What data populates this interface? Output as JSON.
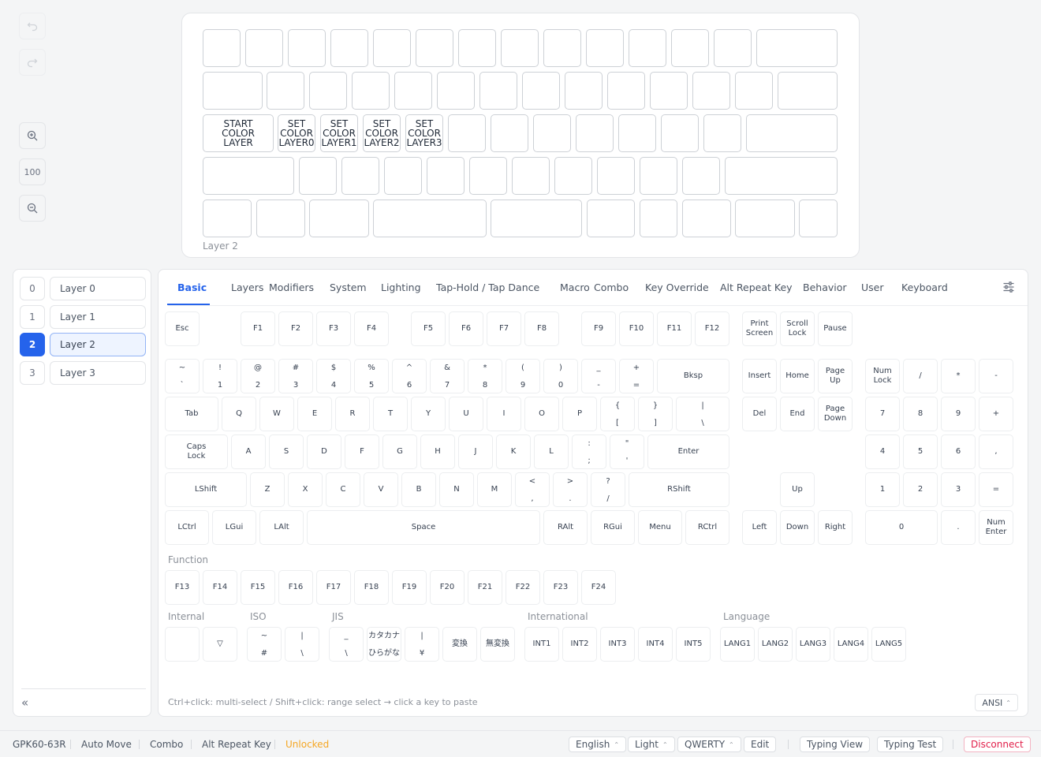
{
  "toolbar": {
    "zoom_value": "100"
  },
  "preview": {
    "layer_caption": "Layer 2",
    "special_keys": [
      "START\nCOLOR\nLAYER",
      "SET\nCOLOR\nLAYER0",
      "SET\nCOLOR\nLAYER1",
      "SET\nCOLOR\nLAYER2",
      "SET\nCOLOR\nLAYER3"
    ]
  },
  "layers": [
    {
      "num": "0",
      "name": "Layer 0"
    },
    {
      "num": "1",
      "name": "Layer 1"
    },
    {
      "num": "2",
      "name": "Layer 2"
    },
    {
      "num": "3",
      "name": "Layer 3"
    }
  ],
  "active_layer": 2,
  "collapse_label": "«",
  "tabs": [
    "Basic",
    "Layers",
    "Modifiers",
    "System",
    "Lighting",
    "Tap-Hold / Tap Dance",
    "Macro",
    "Combo",
    "Key Override",
    "Alt Repeat Key",
    "Behavior",
    "User",
    "Keyboard"
  ],
  "active_tab": "Basic",
  "keys": {
    "fn_row": [
      "Esc",
      "F1",
      "F2",
      "F3",
      "F4",
      "F5",
      "F6",
      "F7",
      "F8",
      "F9",
      "F10",
      "F11",
      "F12",
      "Print\nScreen",
      "Scroll\nLock",
      "Pause"
    ],
    "number_row": [
      [
        "~",
        "`"
      ],
      [
        "!",
        "1"
      ],
      [
        "@",
        "2"
      ],
      [
        "#",
        "3"
      ],
      [
        "$",
        "4"
      ],
      [
        "%",
        "5"
      ],
      [
        "^",
        "6"
      ],
      [
        "&",
        "7"
      ],
      [
        "*",
        "8"
      ],
      [
        "(",
        "9"
      ],
      [
        ")",
        "0"
      ],
      [
        "_",
        "-"
      ],
      [
        "+",
        "="
      ]
    ],
    "bksp": "Bksp",
    "tab_row": [
      "Tab",
      "Q",
      "W",
      "E",
      "R",
      "T",
      "Y",
      "U",
      "I",
      "O",
      "P"
    ],
    "tab_row_dual": [
      [
        "{",
        "["
      ],
      [
        "}",
        "]"
      ],
      [
        "|",
        "\\"
      ]
    ],
    "caps_row": [
      "Caps\nLock",
      "A",
      "S",
      "D",
      "F",
      "G",
      "H",
      "J",
      "K",
      "L"
    ],
    "caps_row_dual": [
      [
        ":",
        ";"
      ],
      [
        "\"",
        "'"
      ]
    ],
    "enter": "Enter",
    "shift_row": [
      "LShift",
      "Z",
      "X",
      "C",
      "V",
      "B",
      "N",
      "M"
    ],
    "shift_row_dual": [
      [
        "<",
        ","
      ],
      [
        ">",
        "."
      ],
      [
        "?",
        "/"
      ]
    ],
    "rshift": "RShift",
    "bottom_row": [
      "LCtrl",
      "LGui",
      "LAlt",
      "Space",
      "RAlt",
      "RGui",
      "Menu",
      "RCtrl"
    ],
    "nav": [
      "Insert",
      "Home",
      "Page\nUp",
      "Del",
      "End",
      "Page\nDown",
      "Up",
      "Left",
      "Down",
      "Right"
    ],
    "numpad": [
      "Num\nLock",
      "/",
      "*",
      "-",
      "7",
      "8",
      "9",
      "+",
      "4",
      "5",
      "6",
      ",",
      "1",
      "2",
      "3",
      "=",
      "0",
      ".",
      "Num\nEnter"
    ]
  },
  "sections": {
    "function": {
      "label": "Function",
      "keys": [
        "F13",
        "F14",
        "F15",
        "F16",
        "F17",
        "F18",
        "F19",
        "F20",
        "F21",
        "F22",
        "F23",
        "F24"
      ]
    },
    "internal": {
      "label": "Internal",
      "keys": [
        "",
        "▽"
      ]
    },
    "iso": {
      "label": "ISO",
      "keys": [
        [
          "~",
          "#"
        ],
        [
          "|",
          "\\"
        ]
      ]
    },
    "jis": {
      "label": "JIS",
      "keys": [
        [
          "_",
          "\\"
        ],
        [
          "カタカナ",
          "ひらがな"
        ],
        [
          "|",
          "¥"
        ]
      ],
      "single": [
        "変換",
        "無変換"
      ]
    },
    "international": {
      "label": "International",
      "keys": [
        "INT1",
        "INT2",
        "INT3",
        "INT4",
        "INT5"
      ]
    },
    "language": {
      "label": "Language",
      "keys": [
        "LANG1",
        "LANG2",
        "LANG3",
        "LANG4",
        "LANG5"
      ]
    }
  },
  "hint": "Ctrl+click: multi-select / Shift+click: range select → click a key to paste",
  "layout_select": "ANSI",
  "status": {
    "device": "GPK60-63R",
    "auto_move": "Auto Move",
    "combo": "Combo",
    "alt_repeat": "Alt Repeat Key",
    "lock_state": "Unlocked",
    "language": "English",
    "theme": "Light",
    "layout": "QWERTY",
    "edit": "Edit",
    "typing_view": "Typing View",
    "typing_test": "Typing Test",
    "disconnect": "Disconnect"
  },
  "colors": {
    "accent": "#2563eb",
    "warning": "#f5a623",
    "danger": "#e11d48"
  }
}
